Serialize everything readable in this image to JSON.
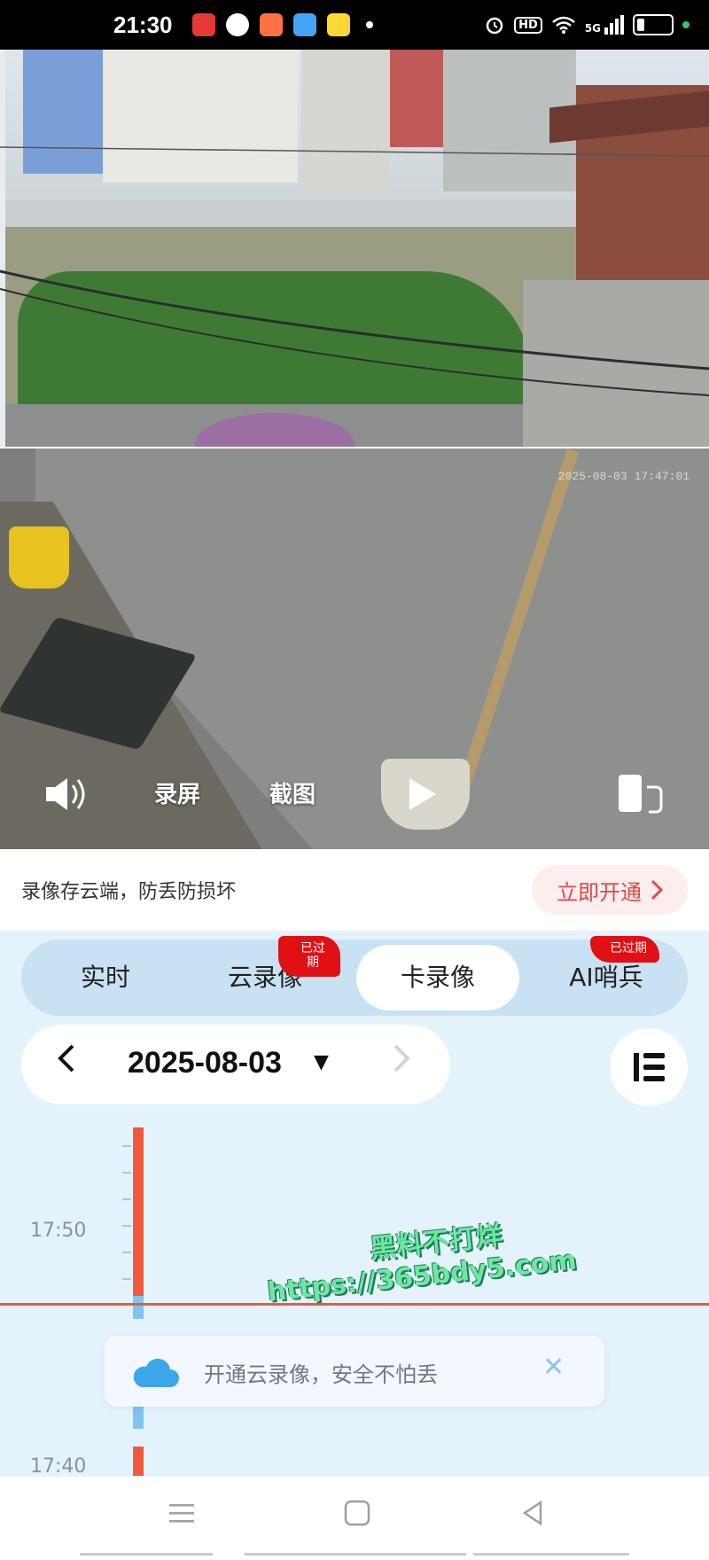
{
  "status_bar": {
    "time": "21:30",
    "notification_icons": [
      "video-app-icon",
      "penguin-app-icon",
      "orange-app-icon",
      "blue-app-icon",
      "yellow-app-icon"
    ],
    "notification_colors": [
      "#e53935",
      "#ffffff",
      "#ff7043",
      "#42a5f5",
      "#fdd835"
    ],
    "right_icons": [
      "alarm-icon",
      "hd-icon",
      "wifi-icon",
      "signal-icon",
      "battery-icon"
    ],
    "hd_label": "HD",
    "signal_label": "5G"
  },
  "camera": {
    "timestamp": "2025-08-03 17:47:01",
    "controls": {
      "audio_icon": "speaker-icon",
      "record_label": "录屏",
      "screenshot_label": "截图",
      "play_icon": "play-icon",
      "orientation_icon": "rotate-screen-icon"
    }
  },
  "promo": {
    "text": "录像存云端，防丢防损坏",
    "button_label": "立即开通"
  },
  "tabs": [
    {
      "label": "实时",
      "active": false,
      "badge": ""
    },
    {
      "label": "云录像",
      "active": false,
      "badge": "已过期"
    },
    {
      "label": "卡录像",
      "active": true,
      "badge": ""
    },
    {
      "label": "AI哨兵",
      "active": false,
      "badge": "已过期"
    }
  ],
  "date_selector": {
    "date": "2025-08-03",
    "caret": "▼"
  },
  "timeline": {
    "labels": [
      "17:50",
      "17:40"
    ]
  },
  "toast": {
    "text": "开通云录像，安全不怕丢"
  },
  "watermark": {
    "line1": "黑料不打烊",
    "line2": "https://365bdy5.com"
  },
  "colors": {
    "accent_red": "#e4464b",
    "badge_red": "#e01015",
    "timeline_orange": "#ef5a3c",
    "timeline_blue": "#7cc6f0",
    "panel_bg": "#e4f2fc"
  }
}
